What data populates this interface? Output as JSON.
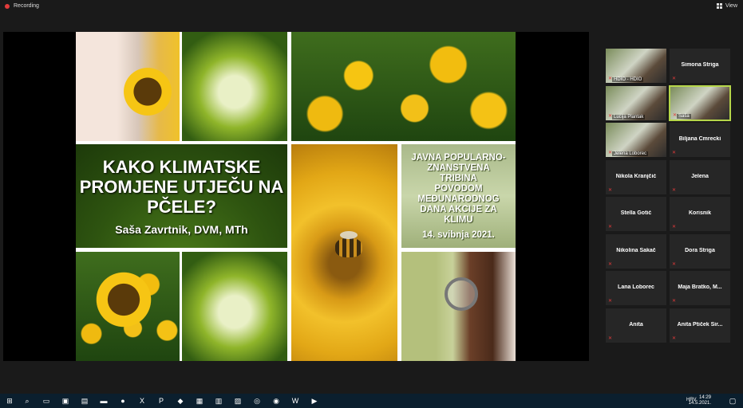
{
  "top": {
    "recording": "Recording",
    "view": "View"
  },
  "slide": {
    "title": "KAKO KLIMATSKE PROMJENE UTJEČU NA PČELE?",
    "author": "Saša Zavrtnik, DVM, MTh",
    "announce": [
      "JAVNA POPULARNO-",
      "ZNANSTVENA",
      "TRIBINA",
      "POVODOM",
      "MEĐUNARODNOG",
      "DANA AKCIJE ZA",
      "KLIMU"
    ],
    "date": "14. svibnja 2021."
  },
  "participants": [
    {
      "name": "HDIO - HDIO",
      "video": true
    },
    {
      "name": "Simona Štriga",
      "video": false
    },
    {
      "name": "Lucija Plantak",
      "video": true
    },
    {
      "name": "Saša",
      "video": true,
      "active": true
    },
    {
      "name": "Jelena Loborec",
      "video": true
    },
    {
      "name": "Biljana Cmrecki",
      "video": false
    },
    {
      "name": "Nikola Kranjčić",
      "video": false
    },
    {
      "name": "Jelena",
      "video": false
    },
    {
      "name": "Stella Gotić",
      "video": false
    },
    {
      "name": "Korisnik",
      "video": false
    },
    {
      "name": "Nikolina Sakač",
      "video": false
    },
    {
      "name": "Dora Štriga",
      "video": false
    },
    {
      "name": "Lana Loborec",
      "video": false
    },
    {
      "name": "Maja Bratko, M...",
      "video": false
    },
    {
      "name": "Anita",
      "video": false
    },
    {
      "name": "Anita Ptiček Sir...",
      "video": false
    }
  ],
  "taskbar": {
    "time": "14:29",
    "date": "14.5.2021.",
    "lang": "HRV"
  },
  "colors": {
    "accent_border": "#b6d64a",
    "mic_muted": "#e23b3b"
  }
}
